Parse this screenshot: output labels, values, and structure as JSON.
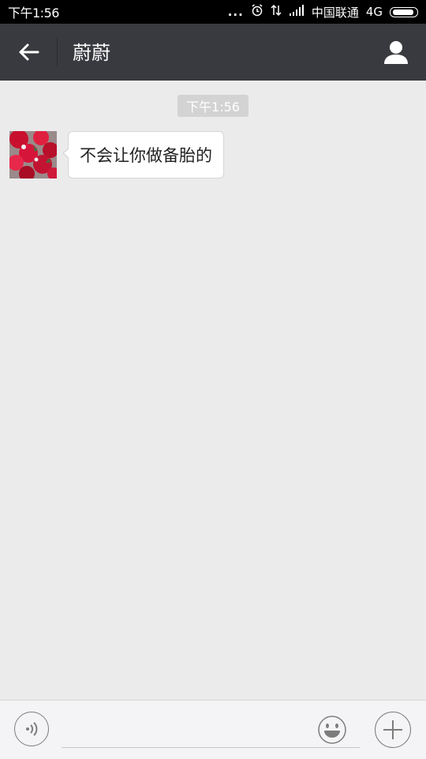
{
  "status_bar": {
    "time": "下午1:56",
    "dots": "...",
    "carrier": "中国联通",
    "network": "4G"
  },
  "nav": {
    "title": "蔚蔚"
  },
  "chat": {
    "timestamp": "下午1:56",
    "messages": [
      {
        "sender": "contact",
        "text": "不会让你做备胎的"
      }
    ]
  },
  "icons": {
    "back": "arrow-left-icon",
    "profile": "person-icon",
    "voice": "voice-icon",
    "emoji": "smiley-icon",
    "plus": "plus-icon"
  },
  "colors": {
    "nav_bg": "#393a3f",
    "chat_bg": "#ebebeb",
    "bubble_bg": "#ffffff"
  }
}
